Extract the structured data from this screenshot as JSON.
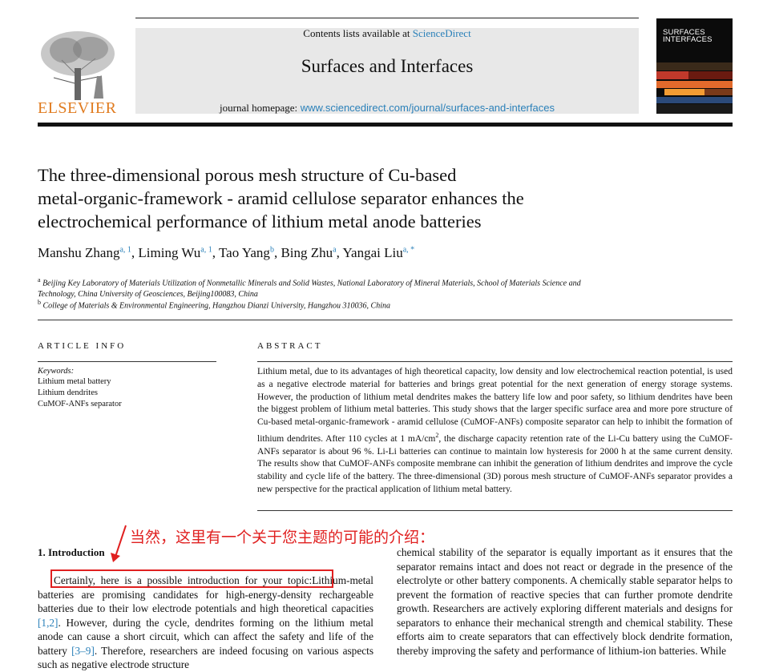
{
  "header": {
    "contents_prefix": "Contents lists available at",
    "contents_link": "ScienceDirect",
    "journal_title": "Surfaces and Interfaces",
    "homepage_label": "journal homepage:",
    "homepage_url": "www.sciencedirect.com/journal/surfaces-and-interfaces",
    "publisher": "ELSEVIER",
    "cover_line1": "SURFACES",
    "cover_line2": "INTERFACES"
  },
  "article": {
    "title_line1": "The three-dimensional porous mesh structure of Cu-based",
    "title_line2": "metal-organic-framework - aramid cellulose separator enhances the",
    "title_line3": "electrochemical performance of lithium metal anode batteries",
    "authors": [
      {
        "name": "Manshu Zhang",
        "sup": "a, 1"
      },
      {
        "name": "Liming Wu",
        "sup": "a, 1"
      },
      {
        "name": "Tao Yang",
        "sup": "b"
      },
      {
        "name": "Bing Zhu",
        "sup": "a"
      },
      {
        "name": "Yangai Liu",
        "sup": "a, *"
      }
    ],
    "affiliations": [
      {
        "mark": "a",
        "line1": "Beijing Key Laboratory of Materials Utilization of Nonmetallic Minerals and Solid Wastes, National Laboratory of Mineral Materials, School of Materials Science and",
        "line2": "Technology, China University of Geosciences, Beijing100083, China"
      },
      {
        "mark": "b",
        "line1": "College of Materials & Environmental Engineering, Hangzhou Dianzi University, Hangzhou 310036, China"
      }
    ]
  },
  "article_info": {
    "heading": "ARTICLE INFO",
    "keywords_label": "Keywords:",
    "keywords": [
      "Lithium metal battery",
      "Lithium dendrites",
      "CuMOF-ANFs separator"
    ]
  },
  "abstract": {
    "heading": "ABSTRACT",
    "part1": "Lithium metal, due to its advantages of high theoretical capacity, low density and low electrochemical reaction potential, is used as a negative electrode material for batteries and brings great potential for the next generation of energy storage systems. However, the production of lithium metal dendrites makes the battery life low and poor safety, so lithium dendrites have been the biggest problem of lithium metal batteries. This study shows that the larger specific surface area and more pore structure of Cu-based metal-organic-framework - aramid cellulose (CuMOF-ANFs) composite separator can help to inhibit the formation of lithium dendrites. After 110 cycles at 1 mA/cm",
    "sup": "2",
    "part2": ", the discharge capacity retention rate of the Li-Cu battery using the CuMOF-ANFs separator is about 96 %. Li-Li batteries can continue to maintain low hysteresis for 2000 h at the same current density. The results show that CuMOF-ANFs composite membrane can inhibit the generation of lithium dendrites and improve the cycle stability and cycle life of the battery. The three-dimensional (3D) porous mesh structure of CuMOF-ANFs separator provides a new perspective for the practical application of lithium metal battery."
  },
  "body": {
    "annotation_cn": "当然，这里有一个关于您主题的可能的介绍：",
    "section_heading": "1.  Introduction",
    "left_boxed": "Certainly, here is a possible introduction for your topic:",
    "left_p1": "Lithium-metal batteries are promising candidates for high-energy-density rechargeable batteries due to their low electrode potentials and high theoretical capacities ",
    "ref1": "[1,2]",
    "left_p2": ". However, during the cycle, dendrites forming on the lithium metal anode can cause a short circuit, which can affect the safety and life of the battery ",
    "ref2": "[3–9]",
    "left_p3": ". Therefore, researchers are indeed focusing on various aspects such as negative electrode structure",
    "right_text": "chemical stability of the separator is equally important as it ensures that the separator remains intact and does not react or degrade in the presence of the electrolyte or other battery components. A chemically stable separator helps to prevent the formation of reactive species that can further promote dendrite growth. Researchers are actively exploring different materials and designs for separators to enhance their mechanical strength and chemical stability. These efforts aim to create separators that can effectively block dendrite formation, thereby improving the safety and performance of lithium-ion batteries. While"
  },
  "colors": {
    "link": "#2a80b9",
    "elsevier_orange": "#e07b1f",
    "annotation_red": "#e02020"
  }
}
